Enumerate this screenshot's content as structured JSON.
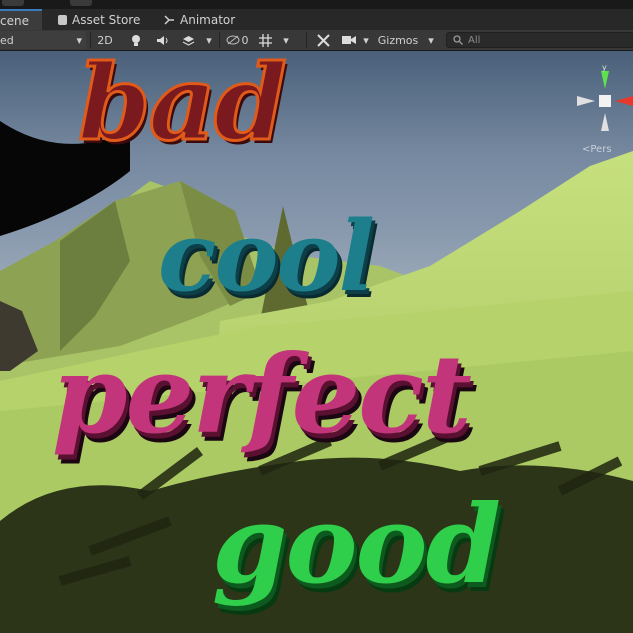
{
  "tabs": [
    {
      "label": "cene",
      "active": true
    },
    {
      "label": "Asset Store",
      "icon": "shopping-bag-icon"
    },
    {
      "label": "Animator",
      "icon": "animator-icon"
    }
  ],
  "toolbar": {
    "shading_mode": "ed",
    "mode_2d": "2D",
    "hidden_count": "0",
    "gizmos_label": "Gizmos",
    "search_placeholder": "All"
  },
  "scene": {
    "words": [
      "bad",
      "cool",
      "perfect",
      "good"
    ],
    "perspective_label": "<Pers"
  },
  "colors": {
    "bad_fill": "#7a1a1e",
    "bad_outline": "#e05a1a",
    "cool": "#1e7f8c",
    "perfect": "#c2357a",
    "good": "#2fcf4c",
    "terrain": "#b7d36c",
    "accent": "#3a79bb"
  }
}
